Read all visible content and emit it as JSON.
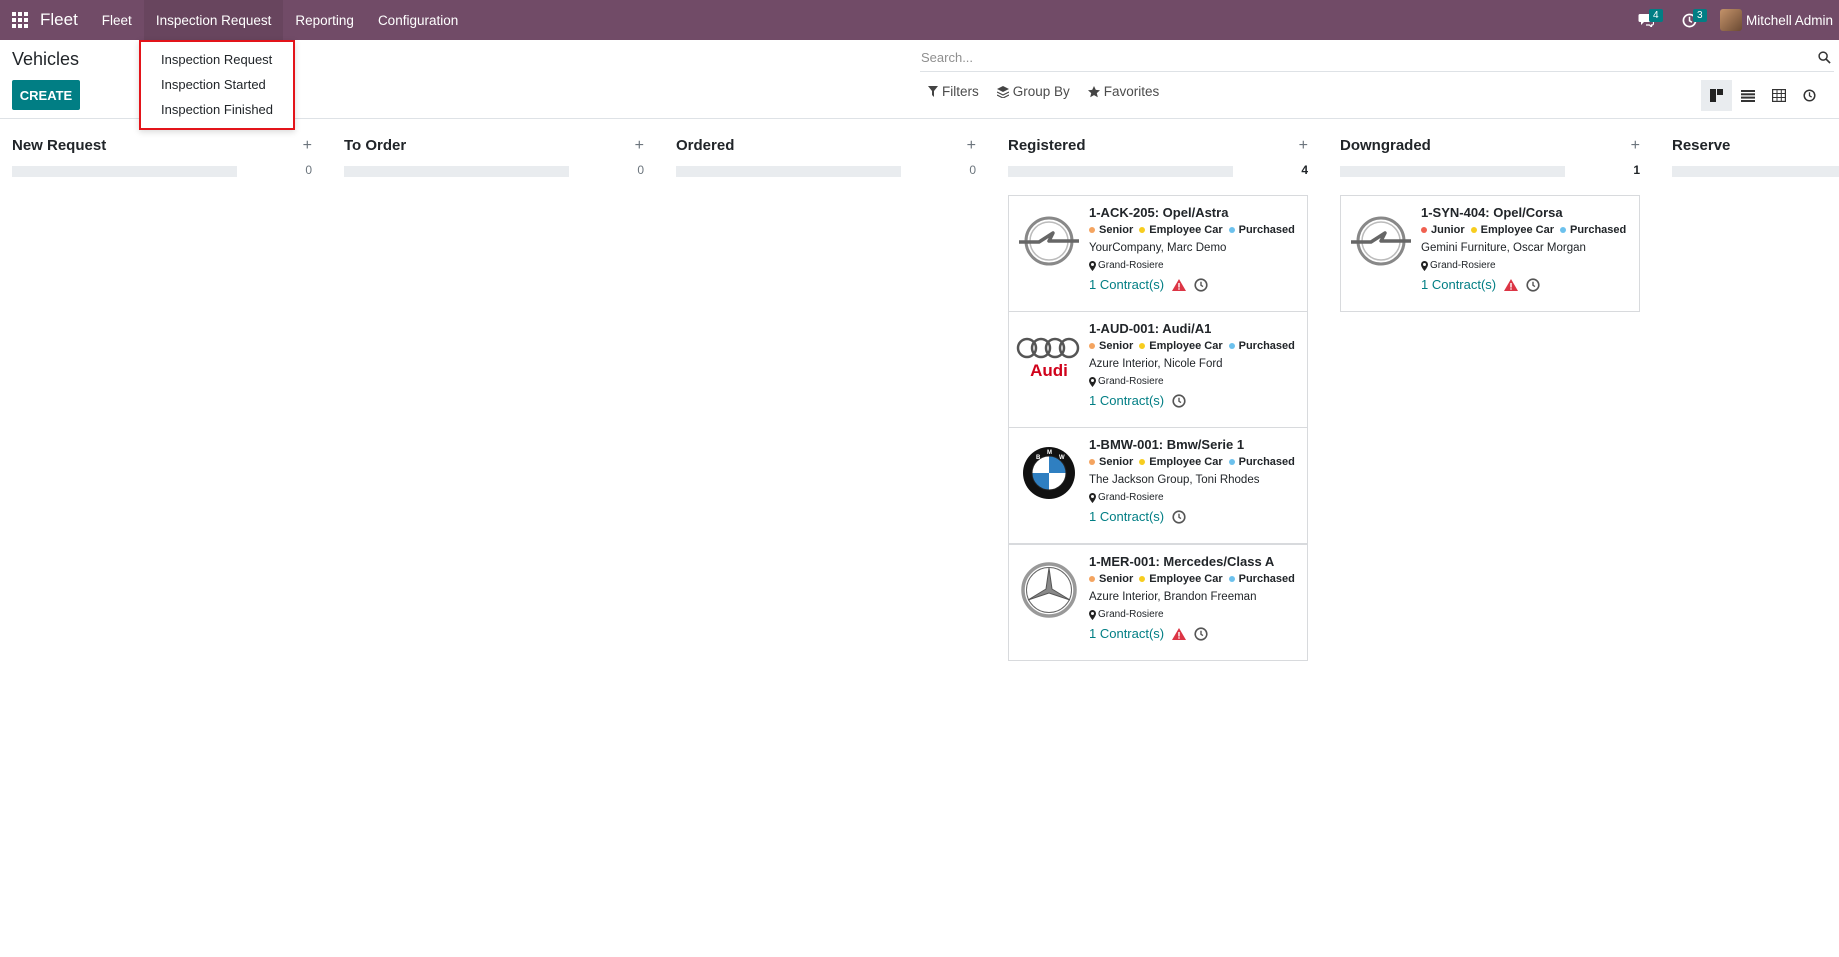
{
  "navbar": {
    "brand": "Fleet",
    "menu": [
      {
        "label": "Fleet"
      },
      {
        "label": "Inspection Request"
      },
      {
        "label": "Reporting"
      },
      {
        "label": "Configuration"
      }
    ],
    "messages_count": "4",
    "activities_count": "3",
    "user_name": "Mitchell Admin"
  },
  "dropdown": {
    "items": [
      {
        "label": "Inspection Request"
      },
      {
        "label": "Inspection Started"
      },
      {
        "label": "Inspection Finished"
      }
    ]
  },
  "control_panel": {
    "title": "Vehicles",
    "create_label": "CREATE",
    "search_placeholder": "Search...",
    "filters_label": "Filters",
    "groupby_label": "Group By",
    "favorites_label": "Favorites"
  },
  "columns": [
    {
      "title": "New Request",
      "count": "0",
      "cards": []
    },
    {
      "title": "To Order",
      "count": "0",
      "cards": []
    },
    {
      "title": "Ordered",
      "count": "0",
      "cards": []
    },
    {
      "title": "Registered",
      "count": "4",
      "cards": [
        {
          "name": "1-ACK-205: Opel/Astra",
          "logo": "opel",
          "tags": [
            {
              "label": "Senior",
              "color": "#f4a460"
            },
            {
              "label": "Employee Car",
              "color": "#f7cd1f"
            },
            {
              "label": "Purchased",
              "color": "#6cc1ed"
            }
          ],
          "driver": "YourCompany, Marc Demo",
          "location": "Grand-Rosiere",
          "contracts": "1 Contract(s)",
          "warning": true
        },
        {
          "name": "1-AUD-001: Audi/A1",
          "logo": "audi",
          "tags": [
            {
              "label": "Senior",
              "color": "#f4a460"
            },
            {
              "label": "Employee Car",
              "color": "#f7cd1f"
            },
            {
              "label": "Purchased",
              "color": "#6cc1ed"
            }
          ],
          "driver": "Azure Interior, Nicole Ford",
          "location": "Grand-Rosiere",
          "contracts": "1 Contract(s)",
          "warning": false
        },
        {
          "name": "1-BMW-001: Bmw/Serie 1",
          "logo": "bmw",
          "tags": [
            {
              "label": "Senior",
              "color": "#f4a460"
            },
            {
              "label": "Employee Car",
              "color": "#f7cd1f"
            },
            {
              "label": "Purchased",
              "color": "#6cc1ed"
            }
          ],
          "driver": "The Jackson Group, Toni Rhodes",
          "location": "Grand-Rosiere",
          "contracts": "1 Contract(s)",
          "warning": false
        },
        {
          "name": "1-MER-001: Mercedes/Class A",
          "logo": "mercedes",
          "tags": [
            {
              "label": "Senior",
              "color": "#f4a460"
            },
            {
              "label": "Employee Car",
              "color": "#f7cd1f"
            },
            {
              "label": "Purchased",
              "color": "#6cc1ed"
            }
          ],
          "driver": "Azure Interior, Brandon Freeman",
          "location": "Grand-Rosiere",
          "contracts": "1 Contract(s)",
          "warning": true
        }
      ]
    },
    {
      "title": "Downgraded",
      "count": "1",
      "cards": [
        {
          "name": "1-SYN-404: Opel/Corsa",
          "logo": "opel",
          "tags": [
            {
              "label": "Junior",
              "color": "#f06050"
            },
            {
              "label": "Employee Car",
              "color": "#f7cd1f"
            },
            {
              "label": "Purchased",
              "color": "#6cc1ed"
            }
          ],
          "driver": "Gemini Furniture, Oscar Morgan",
          "location": "Grand-Rosiere",
          "contracts": "1 Contract(s)",
          "warning": true
        }
      ]
    },
    {
      "title": "Reserve",
      "count": "",
      "cards": []
    }
  ]
}
